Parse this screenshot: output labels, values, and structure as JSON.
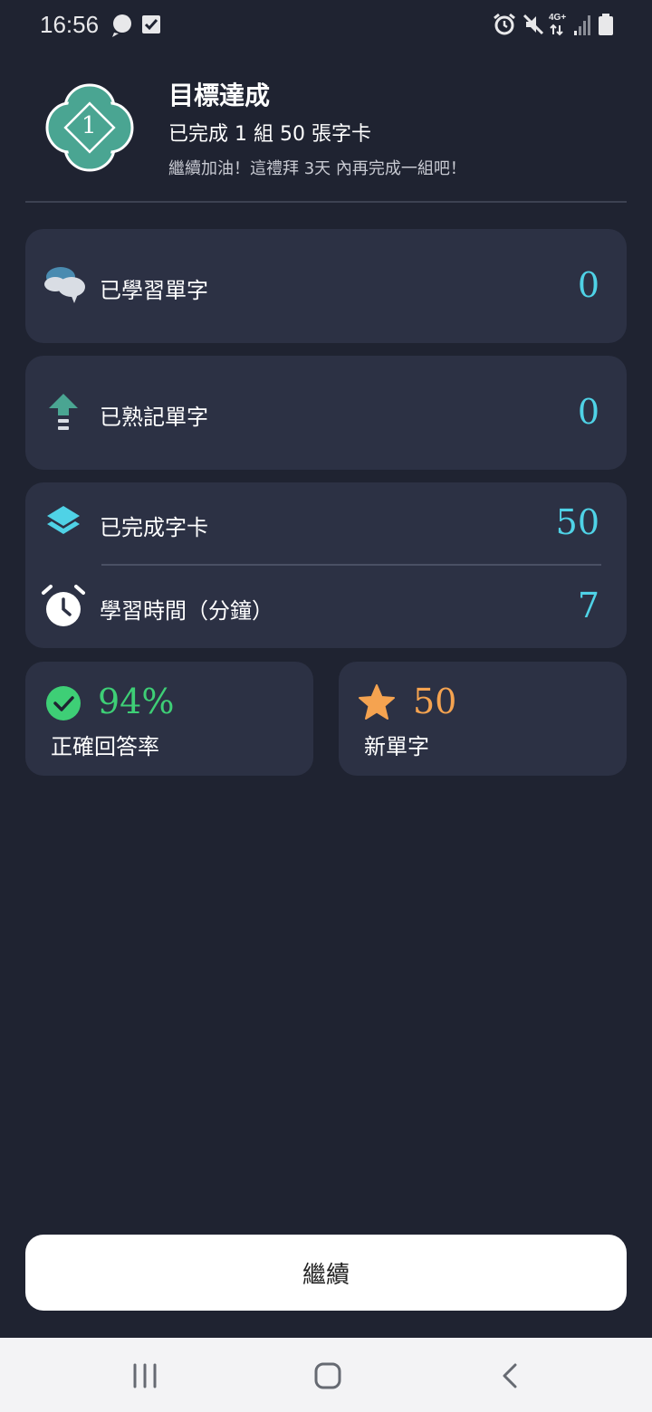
{
  "status_bar": {
    "time": "16:56",
    "left_icons": [
      "chat-bubble-icon",
      "checkbox-icon"
    ],
    "right_icons": [
      "alarm-icon",
      "mute-icon",
      "network-4g-icon",
      "signal-icon",
      "battery-icon"
    ],
    "network_label": "4G+"
  },
  "header": {
    "badge_number": "1",
    "title": "目標達成",
    "subtitle": "已完成 1 組 50 張字卡",
    "message": "繼續加油！這禮拜 3天 內再完成一組吧！"
  },
  "stats": {
    "learned_words": {
      "label": "已學習單字",
      "value": "0",
      "icon": "brain-chat-icon"
    },
    "mastered_words": {
      "label": "已熟記單字",
      "value": "0",
      "icon": "arrow-up-icon"
    },
    "completed_cards": {
      "label": "已完成字卡",
      "value": "50",
      "icon": "layers-icon"
    },
    "study_time": {
      "label": "學習時間（分鐘）",
      "value": "7",
      "icon": "alarm-clock-icon"
    },
    "accuracy": {
      "label": "正確回答率",
      "value": "94%",
      "icon": "check-circle-icon"
    },
    "new_words": {
      "label": "新單字",
      "value": "50",
      "icon": "star-icon"
    }
  },
  "actions": {
    "continue_label": "繼續"
  },
  "nav": {
    "buttons": [
      "recent-apps-icon",
      "home-icon",
      "back-icon"
    ]
  },
  "colors": {
    "background": "#1f2331",
    "card": "#2c3144",
    "value_cyan": "#4fd2e6",
    "accuracy_green": "#3ecf76",
    "new_words_orange": "#f5a350",
    "badge_teal": "#4aa592"
  }
}
